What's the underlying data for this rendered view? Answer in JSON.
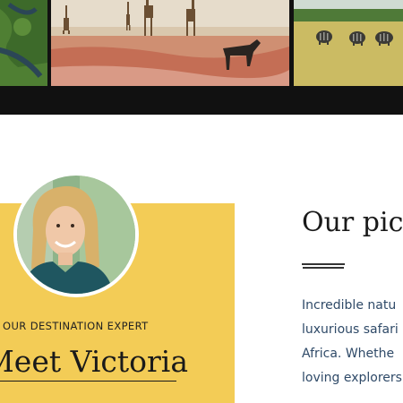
{
  "gallery": {
    "photos": [
      {
        "icon": "wetland-aerial-photo"
      },
      {
        "icon": "giraffes-and-wildebeest-photo"
      },
      {
        "icon": "zebras-on-grassland-photo"
      }
    ]
  },
  "expert": {
    "eyebrow": "OUR DESTINATION EXPERT",
    "heading": "Meet Victoria",
    "avatar_icon": "expert-portrait"
  },
  "intro": {
    "heading": "Our pic",
    "lines": [
      "Incredible natu",
      "luxurious safari",
      "Africa. Whethe",
      "loving explorers"
    ]
  },
  "colors": {
    "card_yellow": "#f3cc56",
    "dark_band": "#111111",
    "body_text": "#2f4a68"
  }
}
